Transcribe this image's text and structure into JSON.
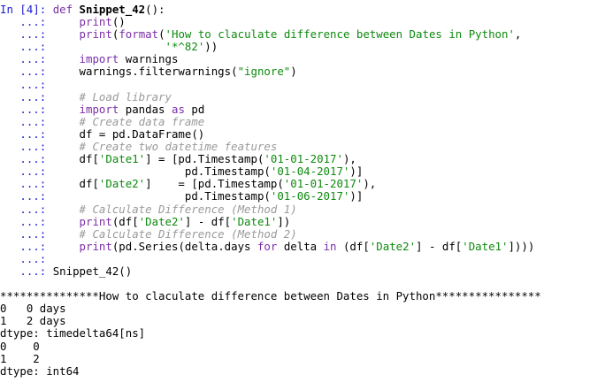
{
  "input": {
    "prompt": "In [4]:",
    "cont_prompt": "   ...:",
    "lines": [
      [
        {
          "t": "def ",
          "c": "kw"
        },
        {
          "t": "Snippet_42",
          "c": "def-name"
        },
        {
          "t": "():",
          "c": ""
        }
      ],
      [
        {
          "t": "    ",
          "c": ""
        },
        {
          "t": "print",
          "c": "fn"
        },
        {
          "t": "()",
          "c": ""
        }
      ],
      [
        {
          "t": "    ",
          "c": ""
        },
        {
          "t": "print",
          "c": "fn"
        },
        {
          "t": "(",
          "c": ""
        },
        {
          "t": "format",
          "c": "fn"
        },
        {
          "t": "(",
          "c": ""
        },
        {
          "t": "'How to claculate difference between Dates in Python'",
          "c": "str"
        },
        {
          "t": ",",
          "c": ""
        }
      ],
      [
        {
          "t": "                 ",
          "c": ""
        },
        {
          "t": "'*^82'",
          "c": "str"
        },
        {
          "t": "))",
          "c": ""
        }
      ],
      [
        {
          "t": "    ",
          "c": ""
        },
        {
          "t": "import",
          "c": "kw"
        },
        {
          "t": " warnings",
          "c": ""
        }
      ],
      [
        {
          "t": "    warnings.filterwarnings(",
          "c": ""
        },
        {
          "t": "\"ignore\"",
          "c": "str"
        },
        {
          "t": ")",
          "c": ""
        }
      ],
      [],
      [
        {
          "t": "    ",
          "c": ""
        },
        {
          "t": "# Load library",
          "c": "com"
        }
      ],
      [
        {
          "t": "    ",
          "c": ""
        },
        {
          "t": "import",
          "c": "kw"
        },
        {
          "t": " pandas ",
          "c": ""
        },
        {
          "t": "as",
          "c": "kw"
        },
        {
          "t": " pd",
          "c": ""
        }
      ],
      [
        {
          "t": "    ",
          "c": ""
        },
        {
          "t": "# Create data frame",
          "c": "com"
        }
      ],
      [
        {
          "t": "    df = pd.DataFrame()",
          "c": ""
        }
      ],
      [
        {
          "t": "    ",
          "c": ""
        },
        {
          "t": "# Create two datetime features",
          "c": "com"
        }
      ],
      [
        {
          "t": "    df[",
          "c": ""
        },
        {
          "t": "'Date1'",
          "c": "str"
        },
        {
          "t": "] = [pd.Timestamp(",
          "c": ""
        },
        {
          "t": "'01-01-2017'",
          "c": "str"
        },
        {
          "t": "),",
          "c": ""
        }
      ],
      [
        {
          "t": "                    pd.Timestamp(",
          "c": ""
        },
        {
          "t": "'01-04-2017'",
          "c": "str"
        },
        {
          "t": ")]",
          "c": ""
        }
      ],
      [
        {
          "t": "    df[",
          "c": ""
        },
        {
          "t": "'Date2'",
          "c": "str"
        },
        {
          "t": "]    = [pd.Timestamp(",
          "c": ""
        },
        {
          "t": "'01-01-2017'",
          "c": "str"
        },
        {
          "t": "),",
          "c": ""
        }
      ],
      [
        {
          "t": "                    pd.Timestamp(",
          "c": ""
        },
        {
          "t": "'01-06-2017'",
          "c": "str"
        },
        {
          "t": ")]",
          "c": ""
        }
      ],
      [
        {
          "t": "    ",
          "c": ""
        },
        {
          "t": "# Calculate Difference (Method 1)",
          "c": "com"
        }
      ],
      [
        {
          "t": "    ",
          "c": ""
        },
        {
          "t": "print",
          "c": "fn"
        },
        {
          "t": "(df[",
          "c": ""
        },
        {
          "t": "'Date2'",
          "c": "str"
        },
        {
          "t": "] - df[",
          "c": ""
        },
        {
          "t": "'Date1'",
          "c": "str"
        },
        {
          "t": "])",
          "c": ""
        }
      ],
      [
        {
          "t": "    ",
          "c": ""
        },
        {
          "t": "# Calculate Difference (Method 2)",
          "c": "com"
        }
      ],
      [
        {
          "t": "    ",
          "c": ""
        },
        {
          "t": "print",
          "c": "fn"
        },
        {
          "t": "(pd.Series(delta.days ",
          "c": ""
        },
        {
          "t": "for",
          "c": "kw"
        },
        {
          "t": " delta ",
          "c": ""
        },
        {
          "t": "in",
          "c": "kw"
        },
        {
          "t": " (df[",
          "c": ""
        },
        {
          "t": "'Date2'",
          "c": "str"
        },
        {
          "t": "] - df[",
          "c": ""
        },
        {
          "t": "'Date1'",
          "c": "str"
        },
        {
          "t": "])))",
          "c": ""
        }
      ],
      [],
      [
        {
          "t": "Snippet_42()",
          "c": ""
        }
      ]
    ]
  },
  "output": {
    "lines": [
      "***************How to claculate difference between Dates in Python****************",
      "0   0 days",
      "1   2 days",
      "dtype: timedelta64[ns]",
      "0    0",
      "1    2",
      "dtype: int64"
    ]
  },
  "colors": {
    "prompt": "#1b1bd2",
    "keyword": "#7b2fa8",
    "string": "#0e8a0e",
    "comment": "#9a9a9a"
  }
}
